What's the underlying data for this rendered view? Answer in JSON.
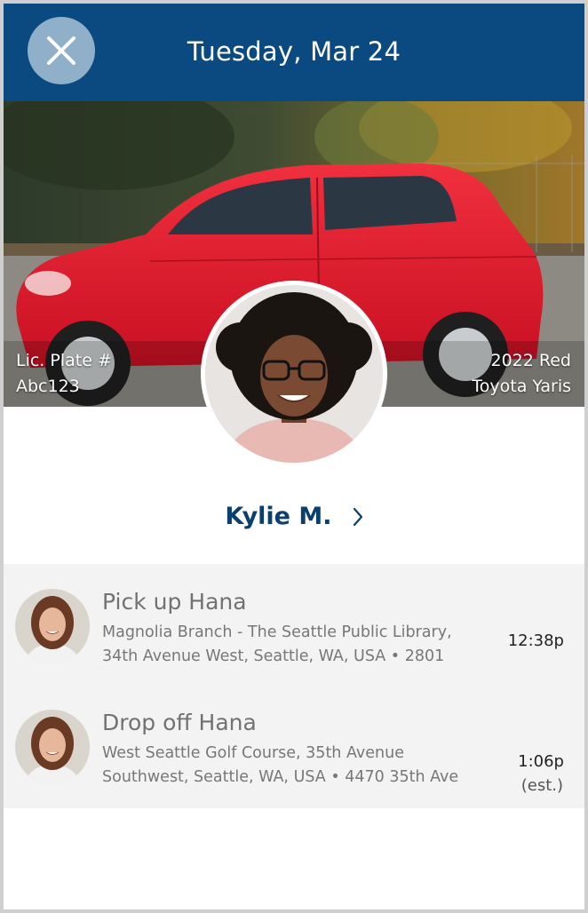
{
  "header": {
    "date": "Tuesday, Mar 24",
    "close_icon": "close-x-icon"
  },
  "vehicle": {
    "plate_label": "Lic. Plate #",
    "plate_value": "Abc123",
    "year_color": "2022 Red",
    "make_model": "Toyota Yaris",
    "car_color": "#e5152a"
  },
  "driver": {
    "name": "Kylie M.",
    "chevron_icon": "chevron-right-icon"
  },
  "stops": [
    {
      "title": "Pick up Hana",
      "address_line1": "Magnolia Branch - The Seattle Public Library,",
      "address_line2": "34th Avenue West, Seattle, WA, USA • 2801",
      "time": "12:38p",
      "time_note": ""
    },
    {
      "title": "Drop off Hana",
      "address_line1": "West Seattle Golf Course, 35th Avenue",
      "address_line2": "Southwest, Seattle, WA, USA • 4470 35th Ave",
      "time": "1:06p",
      "time_note": "(est.)"
    }
  ],
  "colors": {
    "header_bg": "#0b4a80",
    "accent_text": "#0b3f70",
    "list_bg": "#f3f3f3"
  }
}
